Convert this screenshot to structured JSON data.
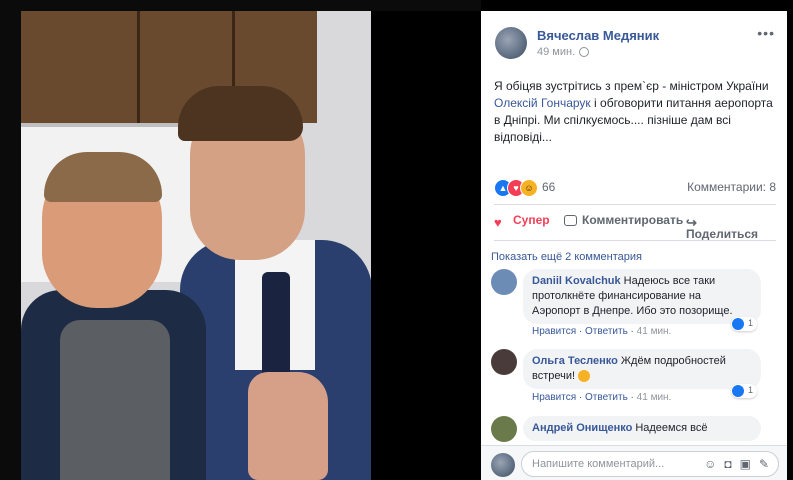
{
  "post": {
    "author": "Вячеслав Медяник",
    "time": "49 мин.",
    "text_part1": "Я обіцяв зустрітись з прем`єр - міністром України ",
    "mention": "Олексій Гончарук",
    "text_part2": " і обговорити питання аеропорта в Дніпрі. Ми спілкуємось.... пізніше дам всі відповіді...",
    "more_icon": "•••"
  },
  "reactions": {
    "count": "66",
    "comments_label": "Комментарии: 8",
    "icons": [
      "like-icon",
      "love-icon",
      "haha-icon"
    ]
  },
  "actions": {
    "love": "Супер",
    "comment": "Комментировать",
    "share": "Поделиться"
  },
  "show_more": "Показать ещё 2 комментария",
  "comments": [
    {
      "name": "Daniil Kovalchuk",
      "text": "Надеюсь все таки протолкнёте финансирование на Аэропорт в Днепре. Ибо это позорище.",
      "like": "Нравится",
      "reply": "Ответить",
      "time": "41 мин.",
      "likes": "1",
      "avatar_color": "#6c8cb5"
    },
    {
      "name": "Ольга Тесленко",
      "text": "Ждём подробностей встречи!",
      "like": "Нравится",
      "reply": "Ответить",
      "time": "41 мин.",
      "likes": "1",
      "avatar_color": "#4a3b3b"
    },
    {
      "name": "Андрей Онищенко",
      "text": "Надеемся всё",
      "avatar_color": "#6b7a4b"
    }
  ],
  "composer": {
    "placeholder": "Напишите комментарий...",
    "icons": [
      "emoji-icon",
      "camera-icon",
      "gif-icon",
      "sticker-icon"
    ]
  },
  "colors": {
    "link": "#385898",
    "like_blue": "#1877f2",
    "love_red": "#f33e58"
  }
}
